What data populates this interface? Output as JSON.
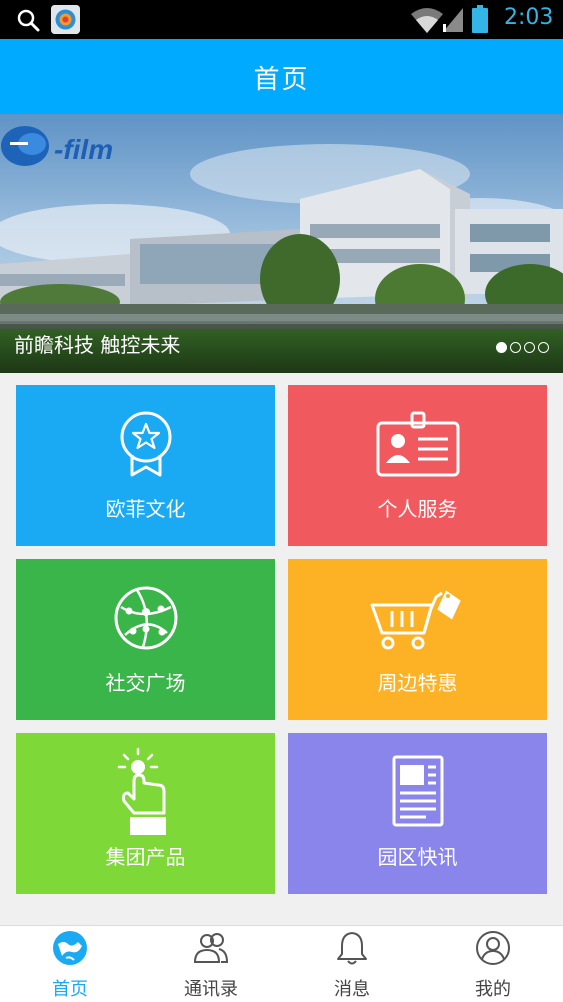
{
  "status_bar": {
    "time": "2:03",
    "icons": [
      "search-icon",
      "app-notification-icon",
      "wifi-icon",
      "signal-icon",
      "battery-icon"
    ],
    "accent_color": "#33b5e5"
  },
  "header": {
    "title": "首页",
    "background": "#00aaff"
  },
  "banner": {
    "logo_text": "-film",
    "caption": "前瞻科技 触控未来",
    "slide_count": 4,
    "active_slide": 1
  },
  "tiles": [
    {
      "label": "欧菲文化",
      "icon": "award-badge-icon",
      "color": "#1aa9f3"
    },
    {
      "label": "个人服务",
      "icon": "id-card-icon",
      "color": "#f05a5f"
    },
    {
      "label": "社交广场",
      "icon": "network-globe-icon",
      "color": "#3ab54a"
    },
    {
      "label": "周边特惠",
      "icon": "shopping-cart-sale-icon",
      "color": "#fdb124"
    },
    {
      "label": "集团产品",
      "icon": "touch-finger-icon",
      "color": "#7ed838"
    },
    {
      "label": "园区快讯",
      "icon": "newspaper-icon",
      "color": "#8985ea"
    }
  ],
  "bottom_nav": {
    "items": [
      {
        "label": "首页",
        "icon": "home-globe-icon",
        "active": true
      },
      {
        "label": "通讯录",
        "icon": "contacts-icon",
        "active": false
      },
      {
        "label": "消息",
        "icon": "bell-icon",
        "active": false
      },
      {
        "label": "我的",
        "icon": "user-profile-icon",
        "active": false
      }
    ],
    "active_color": "#1aa9f3"
  }
}
